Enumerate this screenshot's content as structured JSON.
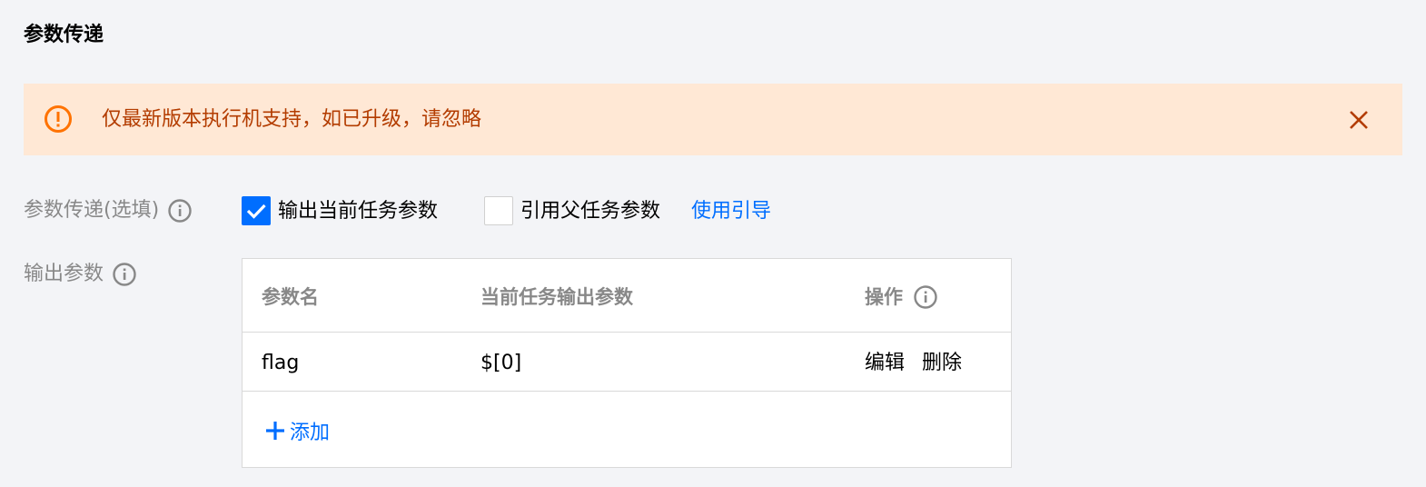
{
  "section_title": "参数传递",
  "alert": {
    "message": "仅最新版本执行机支持，如已升级，请忽略",
    "icon": "warning-circle-icon",
    "close_icon": "close-icon"
  },
  "param_passing": {
    "label": "参数传递(选填)",
    "output_current": {
      "label": "输出当前任务参数",
      "checked": true
    },
    "reference_parent": {
      "label": "引用父任务参数",
      "checked": false
    },
    "guide_link": "使用引导"
  },
  "output_params": {
    "label": "输出参数",
    "columns": [
      "参数名",
      "当前任务输出参数",
      "操作"
    ],
    "rows": [
      {
        "name": "flag",
        "value": "$[0]",
        "actions": [
          "编辑",
          "删除"
        ]
      }
    ],
    "add_label": "添加"
  },
  "colors": {
    "accent": "#006eff",
    "warning_bg": "#ffe8d5",
    "warning_text": "#b33c00",
    "warning_icon": "#ff7200"
  }
}
